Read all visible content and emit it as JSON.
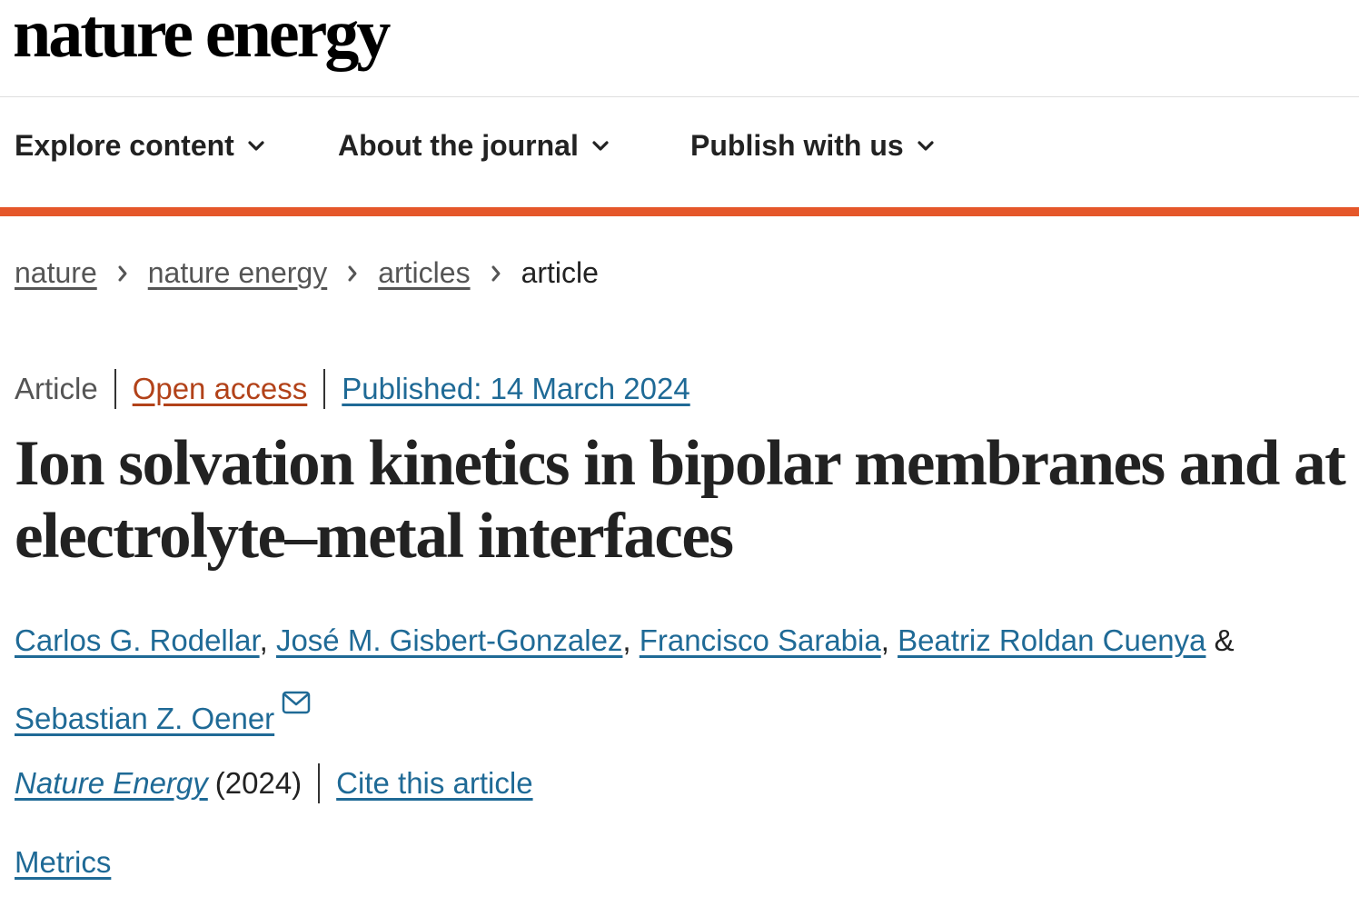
{
  "header": {
    "logo": "nature energy"
  },
  "nav": {
    "items": [
      {
        "label": "Explore content"
      },
      {
        "label": "About the journal"
      },
      {
        "label": "Publish with us"
      }
    ]
  },
  "breadcrumb": {
    "items": [
      "nature",
      "nature energy",
      "articles"
    ],
    "current": "article"
  },
  "meta": {
    "type": "Article",
    "open_access": "Open access",
    "published": "Published: 14 March 2024"
  },
  "article": {
    "title": "Ion solvation kinetics in bipolar membranes and at electrolyte–metal interfaces",
    "authors": [
      "Carlos G. Rodellar",
      "José M. Gisbert-Gonzalez",
      "Francisco Sarabia",
      "Beatriz Roldan Cuenya",
      "Sebastian Z. Oener"
    ],
    "separator": ",",
    "ampersand": "&",
    "journal": "Nature Energy",
    "year": "(2024)",
    "cite": "Cite this article",
    "metrics": "Metrics"
  },
  "colors": {
    "accent": "#e5572a",
    "link": "#1f6a96",
    "open_access": "#b24219"
  },
  "icons": {
    "nav_chevron": "chevron-down-icon",
    "breadcrumb_sep": "chevron-right-icon",
    "corresponding": "mail-icon"
  }
}
